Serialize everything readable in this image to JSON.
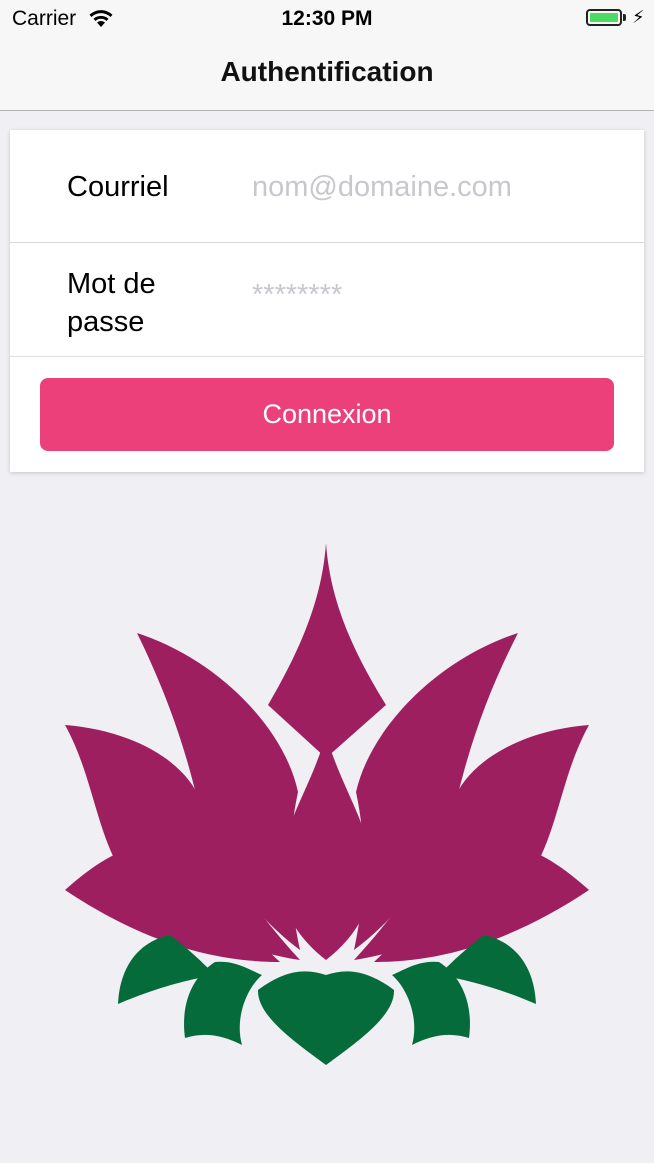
{
  "status_bar": {
    "carrier": "Carrier",
    "time": "12:30 PM",
    "wifi_icon": "wifi-icon",
    "battery_icon": "battery-charging-icon",
    "battery_color": "#4cd964"
  },
  "nav": {
    "title": "Authentification"
  },
  "form": {
    "email_label": "Courriel",
    "email_placeholder": "nom@domaine.com",
    "email_value": "",
    "password_label": "Mot de passe",
    "password_placeholder": "********",
    "password_value": "",
    "submit_label": "Connexion"
  },
  "colors": {
    "accent": "#ec407a",
    "petal": "#9e1f60",
    "leaf": "#066b3b",
    "background": "#efeff4"
  },
  "logo": {
    "icon": "lotus-logo"
  }
}
